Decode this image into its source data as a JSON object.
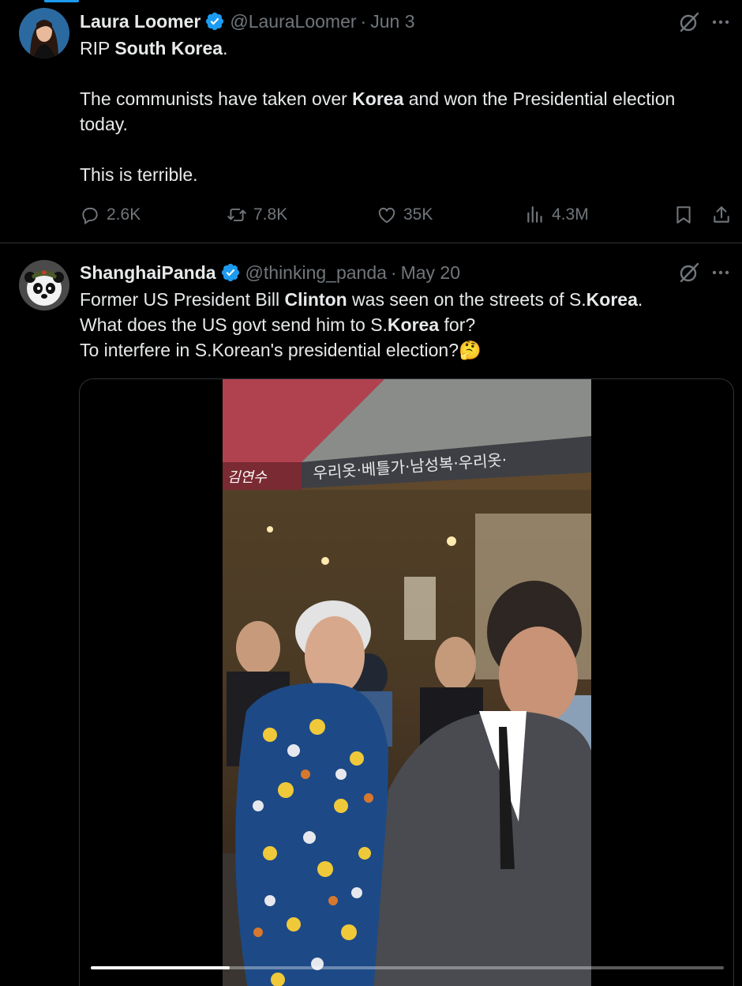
{
  "tweets": [
    {
      "author_name": "Laura Loomer",
      "handle": "@LauraLoomer",
      "separator": "·",
      "date": "Jun 3",
      "text": {
        "l1_pre": "RIP ",
        "l1_bold": "South Korea",
        "l1_post": ".",
        "l2_pre": "The communists have taken over ",
        "l2_bold": "Korea",
        "l2_post": " and won the Presidential election today.",
        "l3": "This is terrible."
      },
      "stats": {
        "replies": "2.6K",
        "reposts": "7.8K",
        "likes": "35K",
        "views": "4.3M"
      }
    },
    {
      "author_name": "ShanghaiPanda",
      "handle": "@thinking_panda",
      "separator": "·",
      "date": "May 20",
      "text": {
        "l1_pre": "Former US President Bill ",
        "l1_bold1": "Clinton",
        "l1_mid": " was seen on the streets of S.",
        "l1_bold2": "Korea",
        "l1_post": ".",
        "l2_pre": "What does the US govt send him to S.",
        "l2_bold": "Korea",
        "l2_post": " for?",
        "l3": "To interfere in S.Korean's presidential election?🤔"
      },
      "media": {
        "type": "video",
        "sign_text": "우리옷·베틀가·남성복·우리옷·",
        "shop_name": "김연수",
        "progress": 0.22
      }
    }
  ],
  "icons": {
    "verified": "verified-badge-icon",
    "grok": "grok-icon",
    "more": "more-options-icon",
    "reply": "reply-icon",
    "repost": "repost-icon",
    "like": "like-icon",
    "views": "views-icon",
    "bookmark": "bookmark-icon",
    "share": "share-icon"
  },
  "colors": {
    "background": "#000000",
    "text": "#e7e9ea",
    "secondary": "#71767b",
    "verified": "#1d9bf0",
    "divider": "#2f3336"
  }
}
